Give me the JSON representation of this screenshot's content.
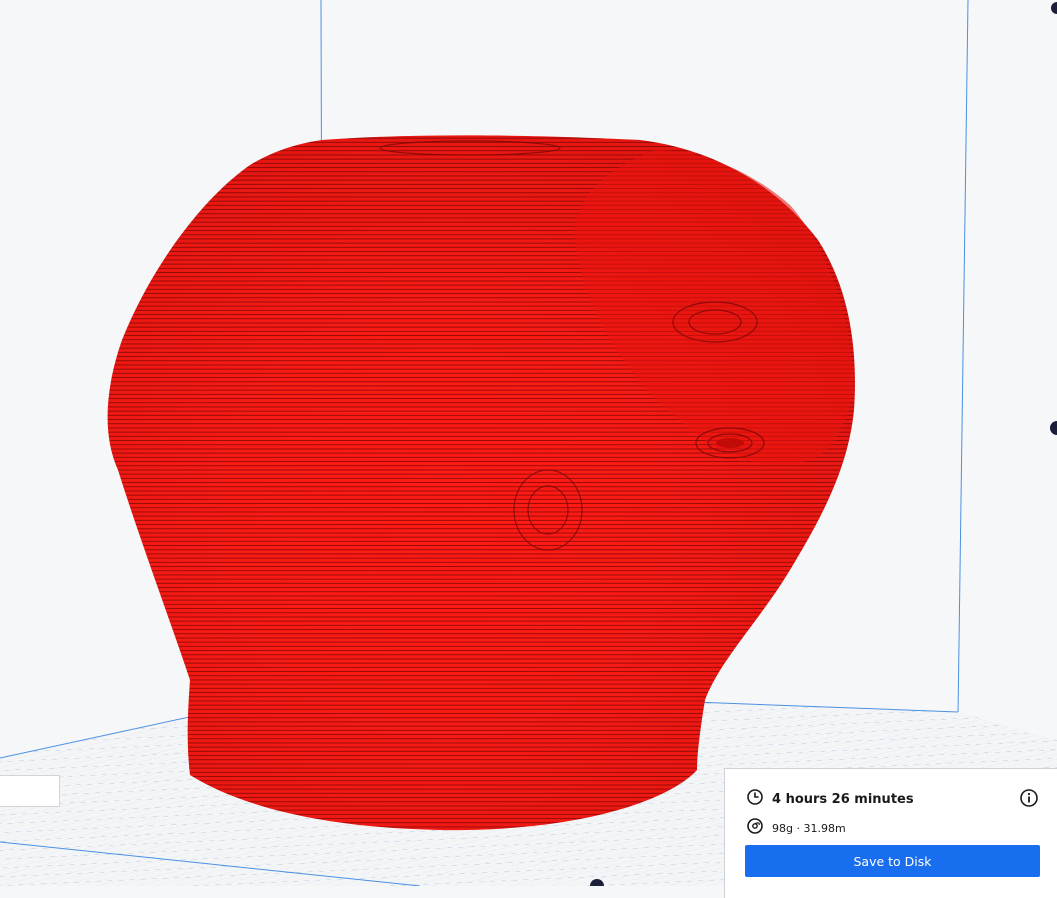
{
  "estimate": {
    "time_icon": "clock-icon",
    "time_label": "4 hours 26 minutes",
    "info_icon": "info-icon",
    "material_icon": "spool-icon",
    "material_label": "98g · 31.98m"
  },
  "actions": {
    "save_label": "Save to Disk"
  },
  "viewport": {
    "model": "sliced-vase-layer-preview",
    "model_color": "#ff1a14",
    "build_plate_grid_color": "#b9c8dc",
    "volume_outline_color": "#4a90e2"
  },
  "colors": {
    "accent": "#196ef0",
    "background": "#f6f7f9"
  }
}
